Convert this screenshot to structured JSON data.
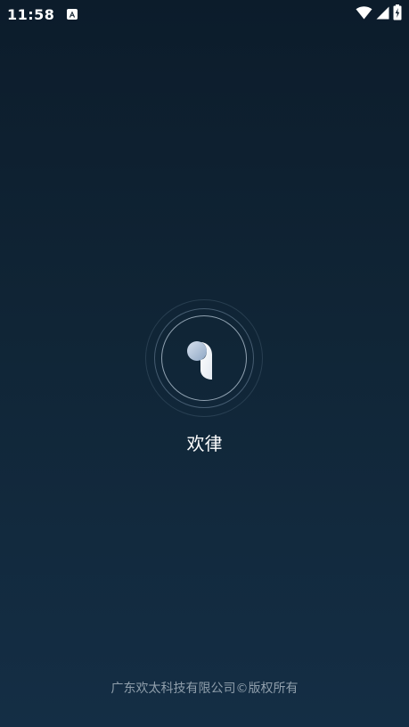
{
  "status_bar": {
    "time": "11:58",
    "notification_icon": "app-notification-icon",
    "wifi_icon": "wifi-icon",
    "signal_icon": "cellular-signal-icon",
    "battery_icon": "battery-charging-icon"
  },
  "splash": {
    "logo_icon": "app-logo-icon",
    "app_name": "欢律",
    "copyright": "广东欢太科技有限公司©版权所有"
  },
  "colors": {
    "background_top": "#0c1c2b",
    "background_bottom": "#142e45",
    "text_primary": "#ffffff",
    "text_secondary": "#8f9eab"
  }
}
